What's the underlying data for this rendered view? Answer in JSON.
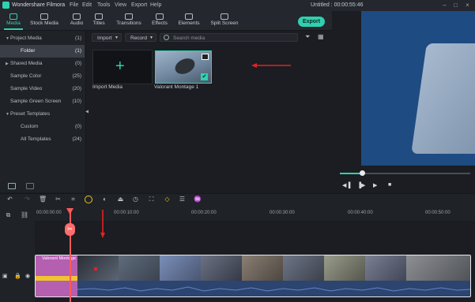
{
  "app": {
    "title": "Wondershare Filmora",
    "menu": [
      "File",
      "Edit",
      "Tools",
      "View",
      "Export",
      "Help"
    ],
    "project_status": "Untitled : 00:00:55:46"
  },
  "tabs": [
    {
      "label": "Media",
      "icon": "media-icon",
      "active": true
    },
    {
      "label": "Stock Media",
      "icon": "stock-media-icon",
      "active": false
    },
    {
      "label": "Audio",
      "icon": "audio-icon",
      "active": false
    },
    {
      "label": "Titles",
      "icon": "titles-icon",
      "active": false
    },
    {
      "label": "Transitions",
      "icon": "transitions-icon",
      "active": false
    },
    {
      "label": "Effects",
      "icon": "effects-icon",
      "active": false
    },
    {
      "label": "Elements",
      "icon": "elements-icon",
      "active": false
    },
    {
      "label": "Split Screen",
      "icon": "split-screen-icon",
      "active": false
    }
  ],
  "export_label": "Export",
  "sidebar": {
    "items": [
      {
        "label": "Project Media",
        "count": "(1)",
        "expanded": true
      },
      {
        "label": "Folder",
        "count": "(1)",
        "selected": true
      },
      {
        "label": "Shared Media",
        "count": "(0)",
        "expanded": false
      },
      {
        "label": "Sample Color",
        "count": "(25)"
      },
      {
        "label": "Sample Video",
        "count": "(20)"
      },
      {
        "label": "Sample Green Screen",
        "count": "(10)"
      },
      {
        "label": "Preset Templates",
        "count": "",
        "expanded": true
      },
      {
        "label": "Custom",
        "count": "(0)"
      },
      {
        "label": "All Templates",
        "count": "(24)"
      }
    ]
  },
  "mediabar": {
    "import_label": "Import",
    "record_label": "Record",
    "search_placeholder": "Search media"
  },
  "media": {
    "import_label": "Import Media",
    "clip_label": "Valorant Montage 1"
  },
  "timeline": {
    "ruler": [
      "00:00:00:00",
      "00:00:10:00",
      "00:00:20:00",
      "00:00:30:00",
      "00:00:40:00",
      "00:00:50:00"
    ],
    "clip_title": "Valorant Montage 1"
  },
  "colors": {
    "accent": "#2fd1b0",
    "playhead": "#ff5a5a",
    "annotation": "#e32222"
  }
}
